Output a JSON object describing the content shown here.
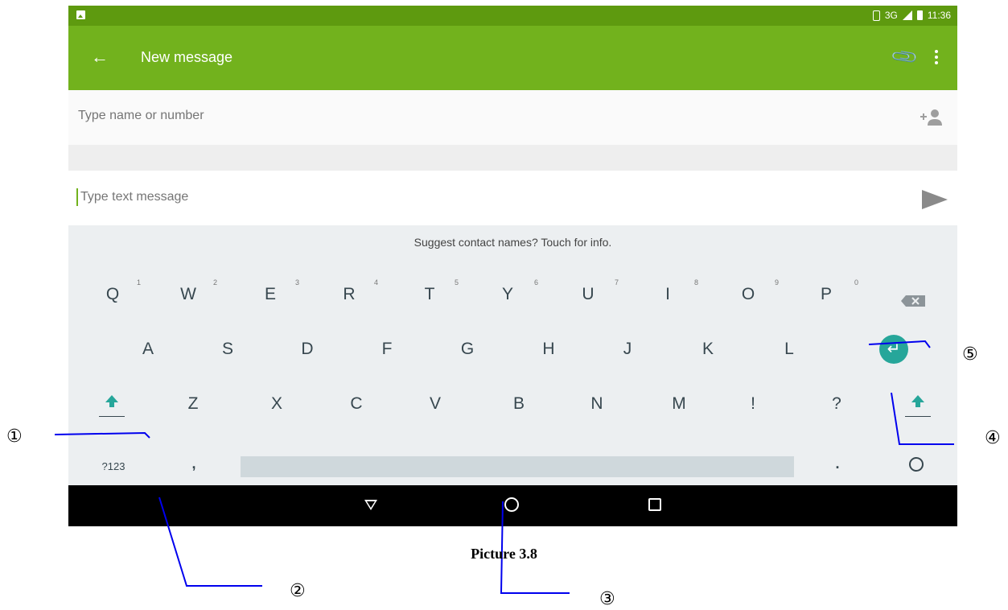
{
  "status_bar": {
    "network": "3G",
    "time": "11:36"
  },
  "toolbar": {
    "title": "New message",
    "back_icon": "arrow-back-icon",
    "attach_icon": "paperclip-icon",
    "menu_icon": "more-vert-icon",
    "color": "#72b21d"
  },
  "recipient": {
    "placeholder": "Type name or number",
    "add_contact_icon": "add-person-icon"
  },
  "compose": {
    "placeholder": "Type text message",
    "send_icon": "send-icon"
  },
  "keyboard": {
    "suggestion": "Suggest contact names? Touch for info.",
    "row1": [
      {
        "label": "Q",
        "hint": "1"
      },
      {
        "label": "W",
        "hint": "2"
      },
      {
        "label": "E",
        "hint": "3"
      },
      {
        "label": "R",
        "hint": "4"
      },
      {
        "label": "T",
        "hint": "5"
      },
      {
        "label": "Y",
        "hint": "6"
      },
      {
        "label": "U",
        "hint": "7"
      },
      {
        "label": "I",
        "hint": "8"
      },
      {
        "label": "O",
        "hint": "9"
      },
      {
        "label": "P",
        "hint": "0"
      }
    ],
    "row2": [
      "A",
      "S",
      "D",
      "F",
      "G",
      "H",
      "J",
      "K",
      "L"
    ],
    "row3": [
      "Z",
      "X",
      "C",
      "V",
      "B",
      "N",
      "M",
      "!",
      "?"
    ],
    "symbols_label": "?123",
    "comma": ",",
    "period": ".",
    "accent_color": "#26a69a"
  },
  "caption": "Picture 3.8",
  "callouts": [
    "①",
    "②",
    "③",
    "④",
    "⑤"
  ]
}
